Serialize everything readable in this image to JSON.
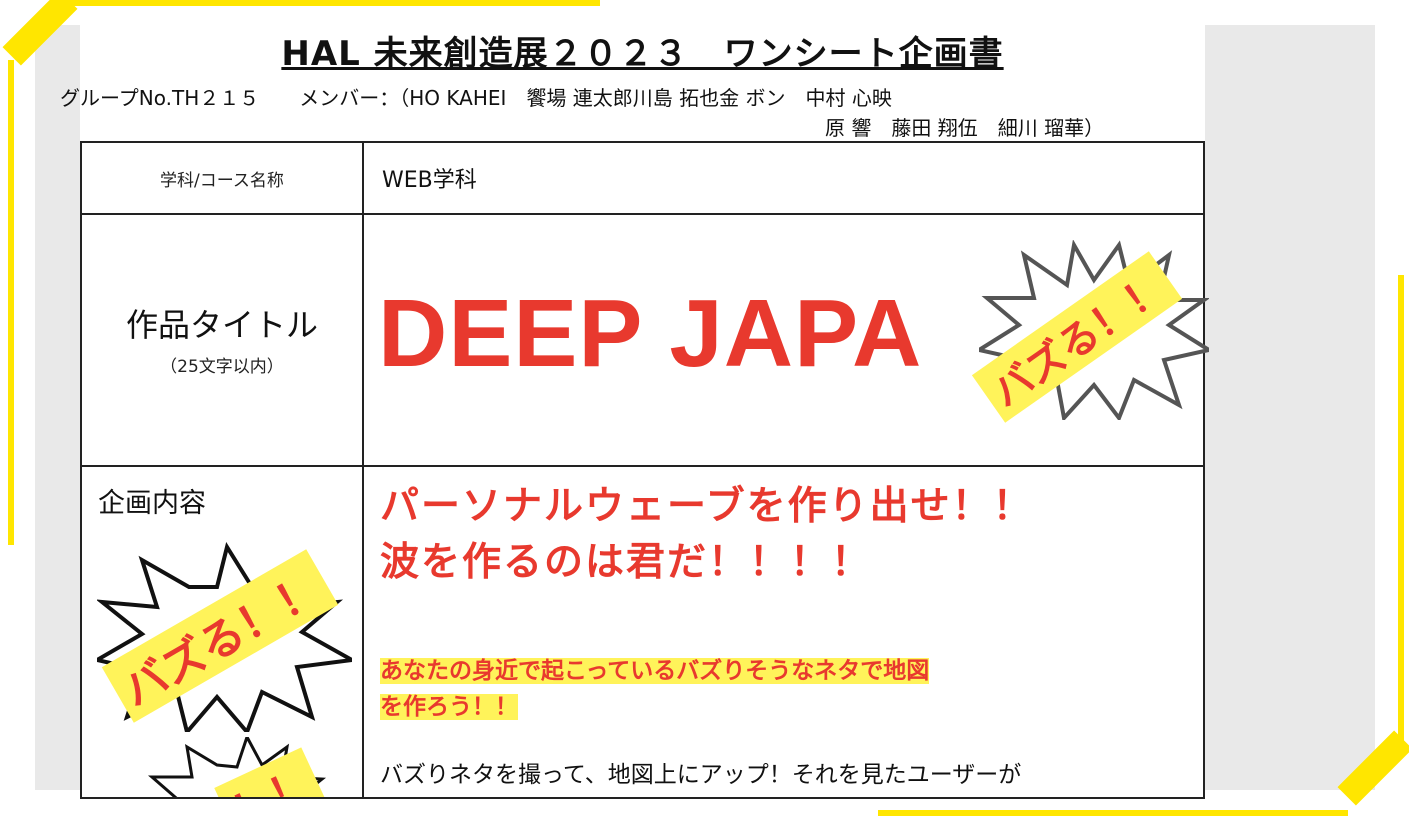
{
  "document": {
    "title": "HAL 未来創造展２０２３　ワンシート企画書",
    "group": "グループNo.TH２１５",
    "members_line1": "メンバー：（HO KAHEI　饗場 連太郎川島 拓也金 ボン　中村 心映",
    "members_line2": "原 響　藤田 翔伍　細川 瑠華）"
  },
  "table": {
    "dept_label": "学科/コース名称",
    "dept_value": "WEB学科",
    "title_label": "作品タイトル",
    "title_sublabel": "（25文字以内）",
    "title_value": "DEEP JAPA",
    "plan_label": "企画内容",
    "plan_heading_1": "パーソナルウェーブを作り出せ！！",
    "plan_heading_2": "波を作るのは君だ！！！！",
    "plan_highlight_1": "あなたの身近で起こっているバズりそうなネタで地図",
    "plan_highlight_2": "を作ろう！！",
    "plan_body": "バズりネタを撮って、地図上にアップ！それを見たユーザーが"
  },
  "stickers": {
    "buzz_label": "バズる！！",
    "partial_label": "！！"
  },
  "colors": {
    "accent_red": "#e8392e",
    "highlight_yellow": "#fff35a",
    "frame_yellow": "#ffe600"
  }
}
